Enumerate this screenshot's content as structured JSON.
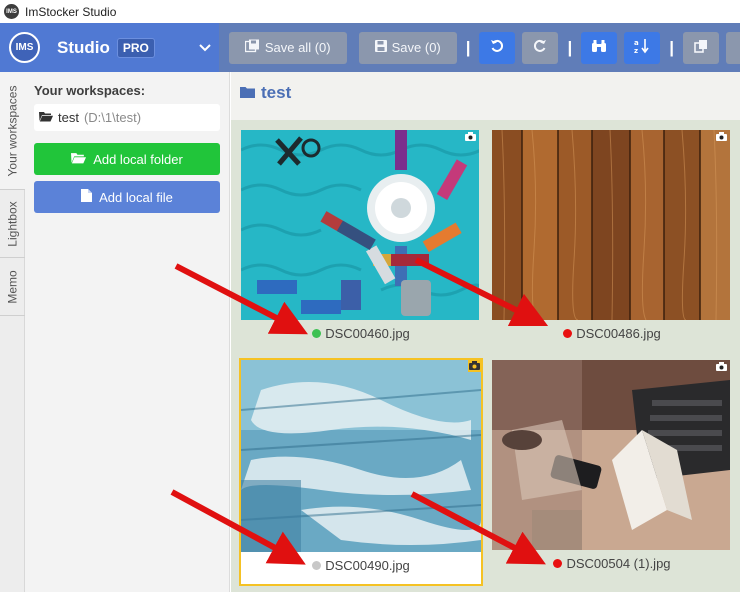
{
  "titlebar": {
    "title": "ImStocker Studio",
    "icon": "app-logo-icon"
  },
  "brand": {
    "logo_text": "IMS",
    "name": "Studio",
    "badge": "PRO"
  },
  "toolbar": {
    "save_all_label": "Save all (0)",
    "save_label": "Save (0)"
  },
  "sidetabs": [
    "Your workspaces",
    "Lightbox",
    "Memo"
  ],
  "panel": {
    "title": "Your workspaces:",
    "workspace_name": "test",
    "workspace_path": "(D:\\1\\test)",
    "add_folder_label": "Add local folder",
    "add_file_label": "Add local file"
  },
  "content": {
    "folder_name": "test",
    "files": [
      {
        "name": "DSC00460.jpg",
        "status_color": "#3cc152",
        "selected": false
      },
      {
        "name": "DSC00486.jpg",
        "status_color": "#e81010",
        "selected": false
      },
      {
        "name": "DSC00490.jpg",
        "status_color": "#c8c8c8",
        "selected": true
      },
      {
        "name": "DSC00504 (1).jpg",
        "status_color": "#e81010",
        "selected": false
      }
    ]
  },
  "colors": {
    "brand_blue": "#5079d3",
    "toolbar_blue": "#607db8",
    "add_folder_green": "#21c53a",
    "selection_yellow": "#f5c224",
    "annotation_red": "#e01010"
  }
}
